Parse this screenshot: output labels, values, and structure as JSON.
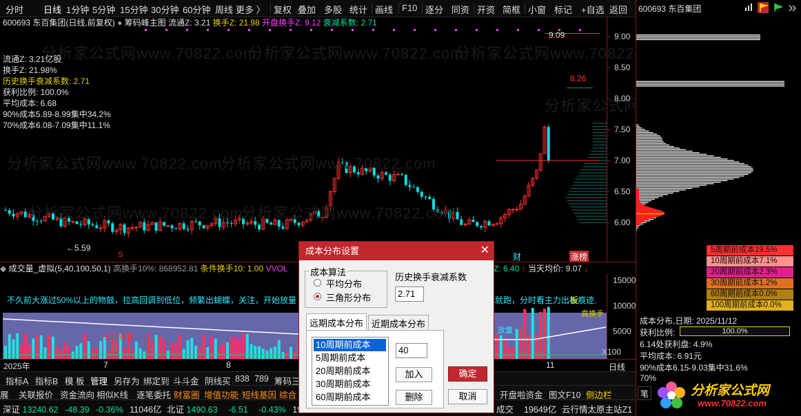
{
  "colors": {
    "up": "#ff3030",
    "down": "#00e0e0",
    "avg": "#ffffff",
    "accent": "#c0282e",
    "yellow": "#e6d200"
  },
  "menu": [
    "分时",
    "日线",
    "1分钟",
    "5分钟",
    "15分钟",
    "30分钟",
    "60分钟",
    "周线",
    "更多 〉",
    "复权",
    "叠加",
    "多股",
    "统计",
    "画线",
    "F10",
    "逐分",
    "同资",
    "开资",
    "简框",
    "小窗",
    "标记",
    "+自选",
    "返回"
  ],
  "menu_active": "日线",
  "header": {
    "code_name": "600693 东百集团(日线,前复权)",
    "indicator": "筹码峰主图",
    "float_label": "流通Z: 3.21",
    "turnover_label": "换手Z: 21.98",
    "open_turnover_label": "开盘换手Z: 9.12",
    "decay_label": "衰减系数: 2.71"
  },
  "left_info": [
    {
      "text": "流通Z:  3.21亿股",
      "cls": "w"
    },
    {
      "text": "换手Z:  21.98%",
      "cls": "w"
    },
    {
      "text": "历史换手衰减系数:  2.71",
      "cls": "y"
    },
    {
      "text": "获利比例: 100.0%",
      "cls": "w"
    },
    {
      "text": "平均成本: 6.68",
      "cls": "w"
    },
    {
      "text": "90%成本5.89-8.99集中34.2%",
      "cls": "w"
    },
    {
      "text": "70%成本6.08-7.09集中11.1%",
      "cls": "w"
    }
  ],
  "watermark": "分析家公式网www.70822.com",
  "chart_labels": {
    "high": "9.09",
    "high2": "8.26",
    "low": "5.59",
    "s_mark": "S",
    "cai": "财",
    "zhangbang": "涨榜"
  },
  "price_axis": [
    "9.00",
    "8.50",
    "8.00",
    "7.50",
    "7.00",
    "6.50",
    "6.00"
  ],
  "volume_header": {
    "name": "成交量_虚拟(5,40,100,50,1)",
    "high_turn": "高换手10%: 868952.81",
    "cond": "条件换手10: 1.00",
    "vvol": "VVOL",
    "x_val": "Z: 6.40",
    "avg_price": "当天均价: 9.07"
  },
  "volume_tip": "不久前大涨过50%以上的物鼓，拉高回调到低位，频繁出蝴蝶，关注，开始放量",
  "volume_tip_right": "能就跑，分时看主力出板痕迹,",
  "volume_axis": [
    "15000",
    "10000",
    "5000",
    "X100"
  ],
  "vol_labels": {
    "zhuli": "主力资金",
    "hgh": "高换手",
    "bl": "放量",
    "bp": "板"
  },
  "date_axis": [
    {
      "label": "2025年"
    },
    {
      "label": "7"
    },
    {
      "label": "8"
    },
    {
      "label": "11"
    }
  ],
  "period_label": "日线",
  "right_panel": {
    "title": "600693 东百集团",
    "legend": [
      {
        "text": "5周期前成本19.5%",
        "bg": "#ff3030"
      },
      {
        "text": "10周期前成本7.1%",
        "bg": "#ff9090"
      },
      {
        "text": "20周期前成本2.3%",
        "bg": "#e0208a"
      },
      {
        "text": "30周期前成本1.2%",
        "bg": "#e07020"
      },
      {
        "text": "60周期前成本0.0%",
        "bg": "#b08010"
      },
      {
        "text": "100周期前成本0.0%",
        "bg": "#e0b020"
      }
    ],
    "dist_date": "成本分布,日期:  2025/11/12",
    "profit_label": "获利比例:",
    "profit_value": "100.0%",
    "profit_point": "6.14处获利盘:  4.9%",
    "avg_cost": "平均成本:  6.91元",
    "cost90": "90%成本6.15-9.03集中31.6%",
    "cost70": "70%"
  },
  "dialog": {
    "title": "成本分布设置",
    "algo_label": "成本算法",
    "opt_avg": "平均分布",
    "opt_tri": "三角形分布",
    "decay_label": "历史换手衰减系数",
    "decay_value": "2.71",
    "tab_far": "远期成本分布",
    "tab_near": "近期成本分布",
    "list": [
      "10周期前成本",
      "5周期前成本",
      "20周期前成本",
      "30周期前成本",
      "60周期前成本"
    ],
    "period_value": "40",
    "add": "加入",
    "delete": "删除",
    "ok": "确定",
    "cancel": "取消"
  },
  "bottom_tabs1": [
    "指标A",
    "指标B",
    "模 板",
    "管理",
    "另存为",
    "绑定到",
    "斗斗金",
    "阴线买",
    "838",
    "789",
    "筹码三"
  ],
  "bottom_tabs2": [
    "展",
    "关联报价",
    "资金流向",
    "相似K线",
    "逐笔委托",
    "财富圈",
    "增值功能",
    "短线基因",
    "综合"
  ],
  "bottom_tabs2_right": [
    "开盘啦资金",
    "图文F10",
    "侧边栏"
  ],
  "bottom_right_box": "笔",
  "status": {
    "sz_label": "深证",
    "sz_val": "13240.62",
    "sz_chg": "-48.39",
    "sz_pct": "-0.36%",
    "sz_amt": "11046亿",
    "bz_label": "北证",
    "bz_val": "1490.63",
    "bz_chg": "-6.51",
    "bz_pct": "-0.43%",
    "bz_amt": "19",
    "mid": "成交",
    "mid_amt": "19649亿",
    "server": "云行情太原主站Z1"
  },
  "logo": {
    "line1": "分析家公式网",
    "line2": "www.70822.com"
  }
}
